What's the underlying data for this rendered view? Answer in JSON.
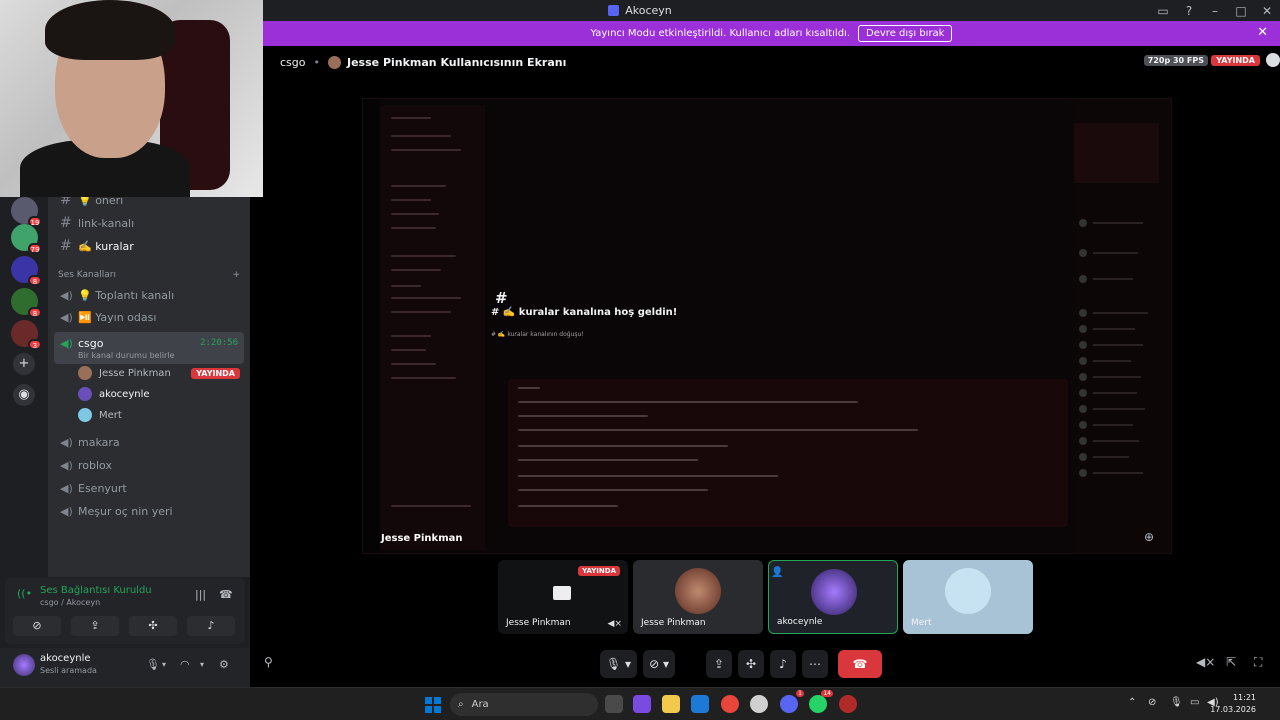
{
  "window": {
    "title": "Akoceyn"
  },
  "banner": {
    "message": "Yayıncı Modu etkinleştirildi. Kullanıcı adları kısaltıldı.",
    "disable_label": "Devre dışı bırak"
  },
  "rail": {
    "badges": [
      "19",
      "79",
      "8",
      "8",
      "3"
    ]
  },
  "sidebar": {
    "text_channels": [
      {
        "label": "💡 öneri"
      },
      {
        "label": "link-kanalı"
      },
      {
        "label": "✍️ kuralar"
      }
    ],
    "voice_section_label": "Ses Kanalları",
    "voice_channels_top": [
      {
        "label": "💡 Toplantı kanalı"
      },
      {
        "label": "⏯️ Yayın odası"
      }
    ],
    "active_voice": {
      "name": "csgo",
      "status": "Bir kanal durumu belirle",
      "time": "2:20:56"
    },
    "voice_users": [
      {
        "name": "Jesse Pinkman",
        "live": "YAYINDA"
      },
      {
        "name": "akoceynle"
      },
      {
        "name": "Mert"
      }
    ],
    "voice_channels_bottom": [
      {
        "label": "makara"
      },
      {
        "label": "roblox"
      },
      {
        "label": "Esenyurt"
      },
      {
        "label": "Meşur oç nin yeri"
      }
    ]
  },
  "voice_panel": {
    "status": "Ses Bağlantısı Kuruldu",
    "sub": "csgo / Akoceyn"
  },
  "user_panel": {
    "name": "akoceynle",
    "state": "Sesli aramada"
  },
  "stage": {
    "channel": "csgo",
    "title": "Jesse Pinkman Kullanıcısının Ekranı",
    "quality": "720p 30 FPS",
    "live": "YAYINDA",
    "screen_name": "Jesse Pinkman",
    "screen_welcome": "# ✍️ kuralar kanalına hoş geldin!",
    "screen_hash": "#",
    "screen_sub": "# ✍️ kuralar kanalının doğuşu!"
  },
  "tiles": [
    {
      "name": "Jesse Pinkman",
      "live": "YAYINDA"
    },
    {
      "name": "Jesse Pinkman"
    },
    {
      "name": "akoceynle"
    },
    {
      "name": "Mert"
    }
  ],
  "taskbar": {
    "search_placeholder": "Ara",
    "time": "11:21",
    "date": "17.03.2026",
    "badges": [
      "1",
      "14"
    ]
  }
}
